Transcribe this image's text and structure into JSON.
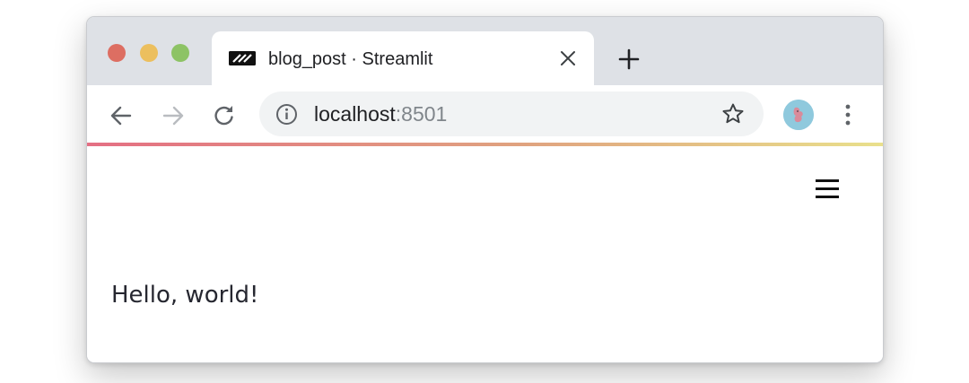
{
  "browser": {
    "tab": {
      "title": "blog_post · Streamlit",
      "favicon": "streamlit-logo-icon",
      "close_icon": "close-icon"
    },
    "new_tab_icon": "plus-icon",
    "nav": {
      "back_icon": "arrow-left-icon",
      "forward_icon": "arrow-right-icon",
      "reload_icon": "reload-icon"
    },
    "address": {
      "site_info_icon": "info-icon",
      "host": "localhost",
      "port": ":8501",
      "bookmark_icon": "star-icon"
    },
    "profile_icon": "avatar-icon",
    "menu_icon": "more-vertical-icon"
  },
  "app": {
    "menu_icon": "hamburger-menu-icon",
    "text": "Hello, world!",
    "decoration_colors": [
      "#e46f83",
      "#e0a37f",
      "#e9e08c"
    ]
  }
}
